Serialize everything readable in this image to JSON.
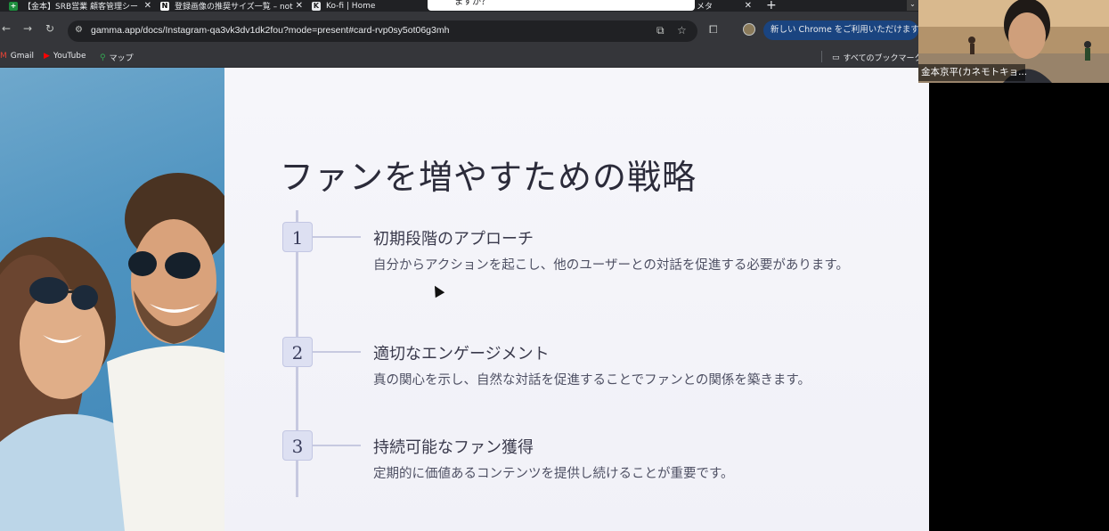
{
  "browser": {
    "tabs": [
      {
        "label": "【金本】SRB営業 顧客管理シー",
        "icon": "sheets-icon",
        "color": "#1e8e3e"
      },
      {
        "label": "登録画像の推奨サイズ一覧 – not",
        "icon": "notion-icon",
        "color": "#ffffff"
      },
      {
        "label": "Ko-fi | Home",
        "icon": "kofi-icon",
        "color": "#e8eaed"
      }
    ],
    "popup_text": "ますか？",
    "partial_tab_label": "メタ",
    "new_tab_symbol": "+",
    "url": "gamma.app/docs/Instagram-qa3vk3dv1dk2fou?mode=present#card-rvp0sy5ot06g3mh",
    "update_pill": "新しい Chrome をご利用いただけます",
    "bookmarks": [
      {
        "label": "Gmail",
        "icon": "gmail-icon"
      },
      {
        "label": "YouTube",
        "icon": "youtube-icon"
      },
      {
        "label": "マップ",
        "icon": "maps-icon"
      }
    ],
    "all_bookmarks": "すべてのブックマーク"
  },
  "slide": {
    "title": "ファンを増やすための戦略",
    "steps": [
      {
        "number": "1",
        "title": "初期段階のアプローチ",
        "desc": "自分からアクションを起こし、他のユーザーとの対話を促進する必要があります。"
      },
      {
        "number": "2",
        "title": "適切なエンゲージメント",
        "desc": "真の関心を示し、自然な対話を促進することでファンとの関係を築きます。"
      },
      {
        "number": "3",
        "title": "持続可能なファン獲得",
        "desc": "定期的に価値あるコンテンツを提供し続けることが重要です。"
      }
    ]
  },
  "video": {
    "participant_name": "金本京平(カネモトキョ..."
  }
}
